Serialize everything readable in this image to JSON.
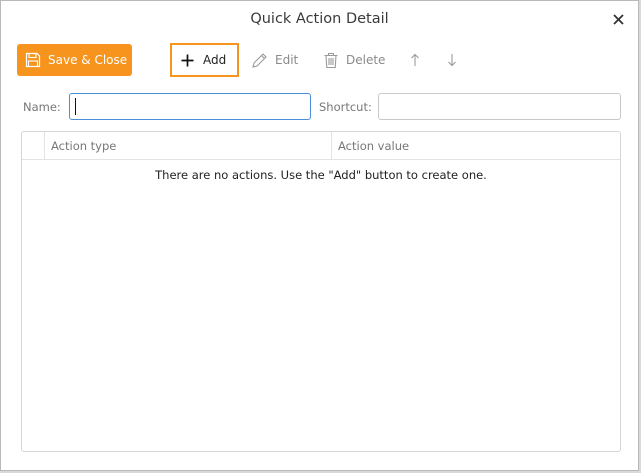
{
  "window": {
    "title": "Quick Action Detail",
    "close_icon": "close-icon"
  },
  "toolbar": {
    "save_close_label": "Save & Close",
    "add_label": "Add",
    "edit_label": "Edit",
    "delete_label": "Delete",
    "up_icon": "arrow-up-icon",
    "down_icon": "arrow-down-icon"
  },
  "form": {
    "name_label": "Name:",
    "name_value": "",
    "shortcut_label": "Shortcut:",
    "shortcut_value": ""
  },
  "grid": {
    "columns": [
      "Action type",
      "Action value"
    ],
    "rows": [],
    "empty_message": "There are no actions. Use the \"Add\" button to create one."
  },
  "colors": {
    "accent": "#f7941d",
    "focus": "#4a8fd8",
    "disabled": "#8a8a8a"
  }
}
